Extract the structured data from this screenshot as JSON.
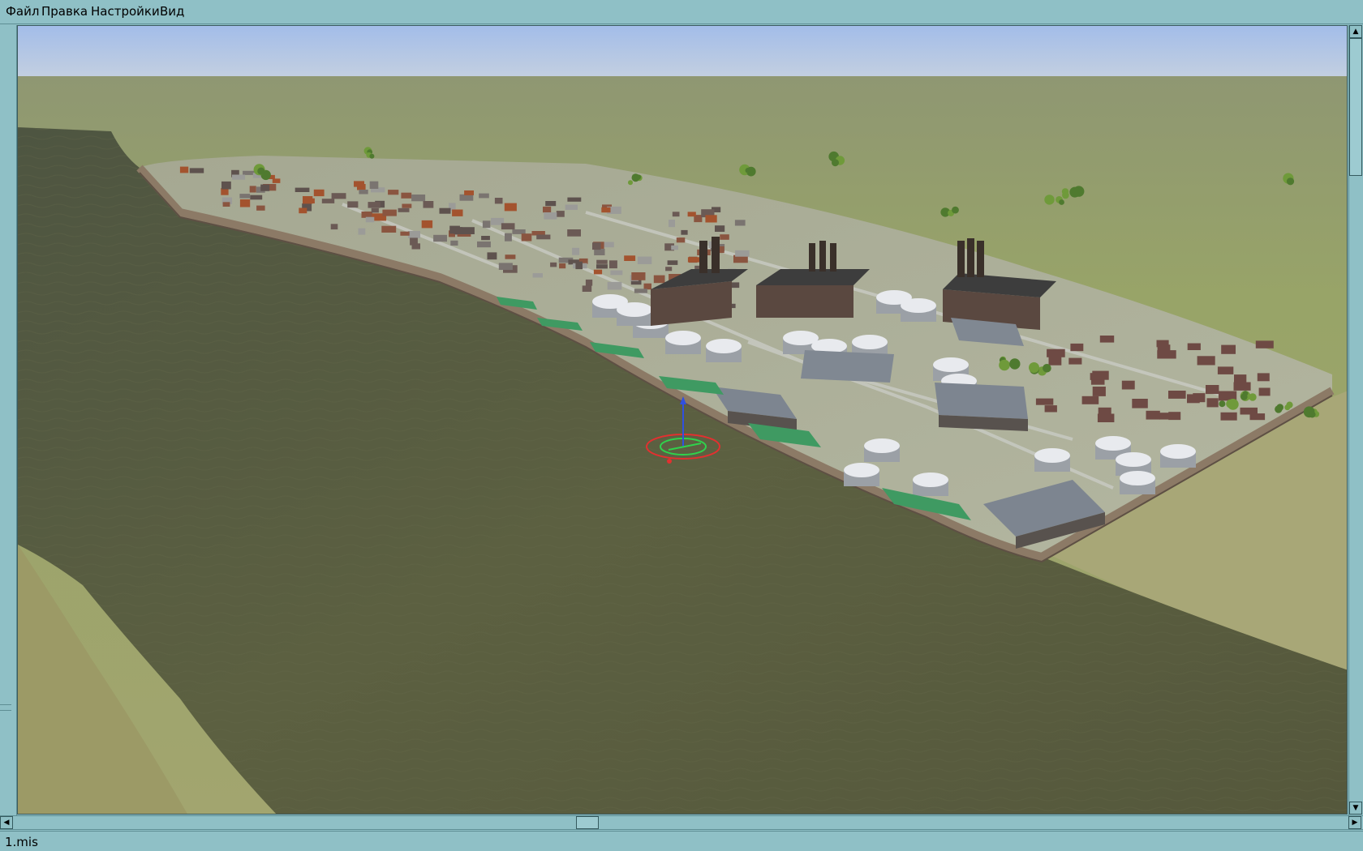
{
  "menu": {
    "file": "Файл",
    "edit": "Правка",
    "settings": "Настройки",
    "view": "Вид"
  },
  "viewport": {
    "description_colors": {
      "sky": "#a7c0e8",
      "water": "#5a5e3e",
      "grass": "#9aa46a"
    }
  },
  "scrollbars": {
    "up_arrow": "▲",
    "down_arrow": "▼",
    "left_arrow": "◀",
    "right_arrow": "▶"
  },
  "status": {
    "filename": "1.mis"
  }
}
